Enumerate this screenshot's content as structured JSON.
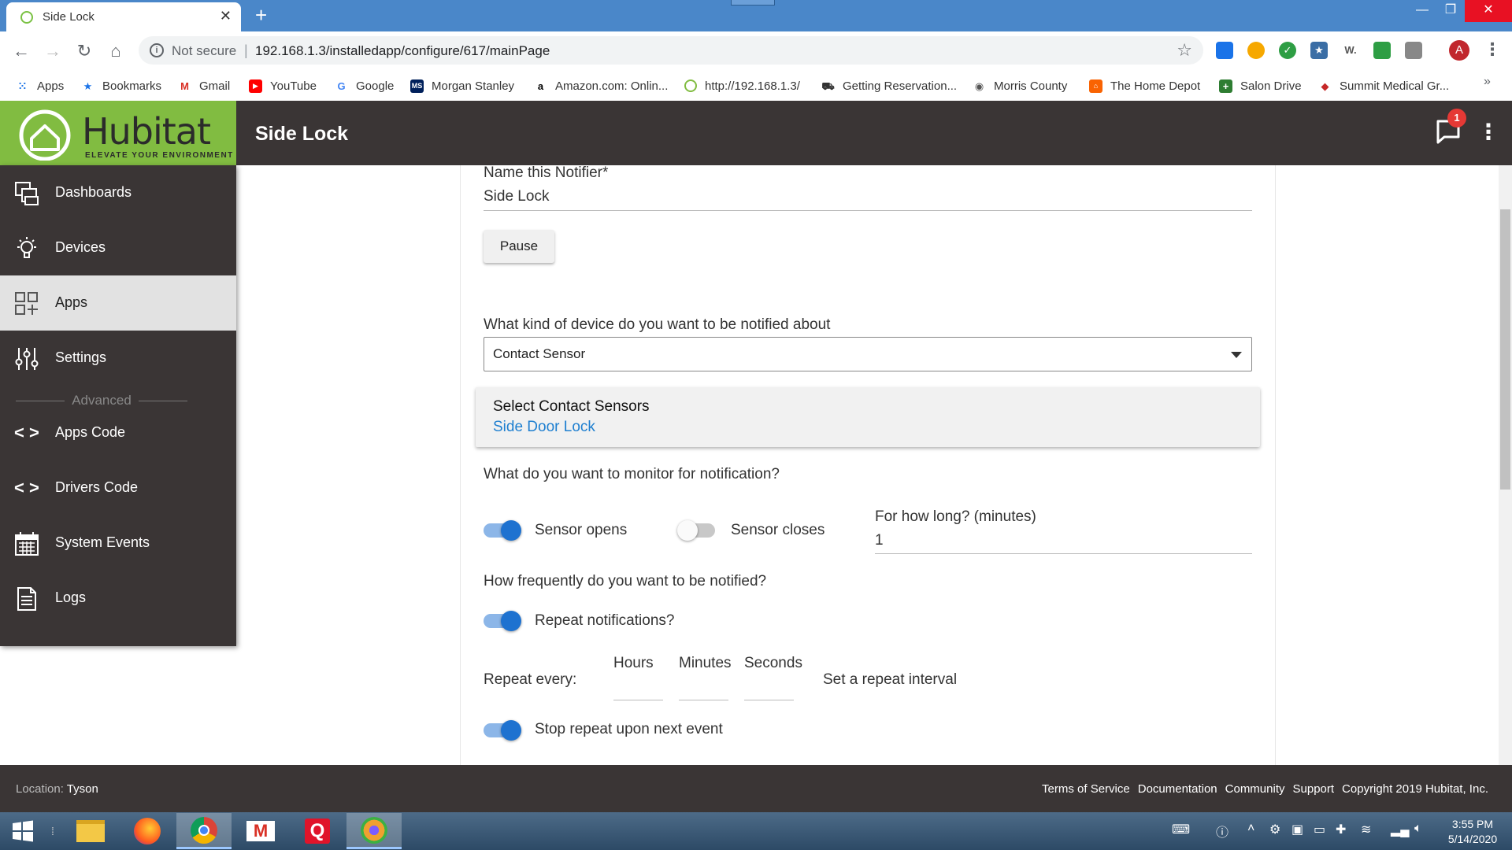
{
  "browser": {
    "tab_title": "Side Lock",
    "tab_close": "✕",
    "new_tab": "+",
    "window_min": "—",
    "window_max": "❐",
    "window_close": "✕",
    "security_label": "Not secure",
    "url": "192.168.1.3/installedapp/configure/617/mainPage",
    "bookmarks": [
      {
        "label": "Apps",
        "icon": "apps-grid-icon",
        "color": "#1a73e8"
      },
      {
        "label": "Bookmarks",
        "icon": "star-icon",
        "color": "#1a73e8"
      },
      {
        "label": "Gmail",
        "icon": "gmail-icon",
        "color": "#d93025"
      },
      {
        "label": "YouTube",
        "icon": "youtube-icon",
        "color": "#ff0000"
      },
      {
        "label": "Google",
        "icon": "google-icon",
        "color": "#4285f4"
      },
      {
        "label": "Morgan Stanley",
        "icon": "ms-icon",
        "color": "#00205b"
      },
      {
        "label": "Amazon.com: Onlin...",
        "icon": "amazon-icon",
        "color": "#000000"
      },
      {
        "label": "http://192.168.1.3/",
        "icon": "hubitat-icon",
        "color": "#81bc41"
      },
      {
        "label": "Getting Reservation...",
        "icon": "car-icon",
        "color": "#333333"
      },
      {
        "label": "Morris  County",
        "icon": "globe-icon",
        "color": "#555555"
      },
      {
        "label": "The Home Depot",
        "icon": "homedepot-icon",
        "color": "#f96302"
      },
      {
        "label": "Salon Drive",
        "icon": "cross-icon",
        "color": "#2e7d32"
      },
      {
        "label": "Summit Medical Gr...",
        "icon": "diamond-icon",
        "color": "#c62828"
      }
    ],
    "bookmarks_more": "»",
    "profile_initial": "A"
  },
  "header": {
    "brand": "Hubitat",
    "tagline": "ELEVATE YOUR ENVIRONMENT",
    "title": "Side Lock",
    "notification_count": "1"
  },
  "sidebar": {
    "items": [
      {
        "label": "Dashboards",
        "icon": "dashboards-icon"
      },
      {
        "label": "Devices",
        "icon": "devices-bulb-icon"
      },
      {
        "label": "Apps",
        "icon": "apps-icon"
      },
      {
        "label": "Settings",
        "icon": "settings-sliders-icon"
      },
      {
        "label": "Apps Code",
        "icon": "code-icon"
      },
      {
        "label": "Drivers Code",
        "icon": "code-icon"
      },
      {
        "label": "System Events",
        "icon": "calendar-icon"
      },
      {
        "label": "Logs",
        "icon": "logs-document-icon"
      }
    ],
    "advanced_label": "Advanced"
  },
  "form": {
    "name_label": "Name this Notifier*",
    "name_value": "Side Lock",
    "pause_button": "Pause",
    "device_kind_label": "What kind of device do you want to be notified about",
    "device_kind_value": "Contact Sensor",
    "select_sensors_label": "Select Contact Sensors",
    "select_sensors_value": "Side Door Lock",
    "monitor_label": "What do you want to monitor for notification?",
    "sensor_opens": {
      "label": "Sensor opens",
      "on": true
    },
    "sensor_closes": {
      "label": "Sensor closes",
      "on": false
    },
    "duration_label": "For how long? (minutes)",
    "duration_value": "1",
    "frequency_label": "How frequently do you want to be notified?",
    "repeat_notifications": {
      "label": "Repeat notifications?",
      "on": true
    },
    "repeat_every_label": "Repeat every:",
    "hours_label": "Hours",
    "minutes_label": "Minutes",
    "seconds_label": "Seconds",
    "repeat_interval_hint": "Set a repeat interval",
    "stop_repeat": {
      "label": "Stop repeat upon next event",
      "on": true
    }
  },
  "footer": {
    "location_label": "Location:",
    "location_value": "Tyson",
    "links": [
      "Terms of Service",
      "Documentation",
      "Community",
      "Support"
    ],
    "copyright": "Copyright 2019 Hubitat, Inc."
  },
  "taskbar": {
    "time": "3:55 PM",
    "date": "5/14/2020"
  },
  "colors": {
    "hubitat_green": "#81bc41",
    "header_dark": "#3a3535",
    "toggle_on": "#1e72d0",
    "link_blue": "#1e7fd0"
  }
}
